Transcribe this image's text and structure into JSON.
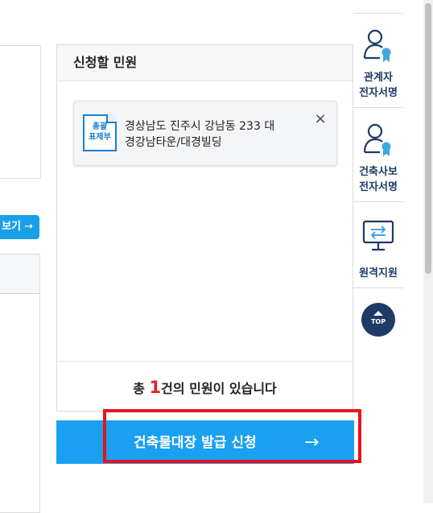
{
  "left": {
    "more_button_label": "보기",
    "more_button_arrow": "→"
  },
  "panel": {
    "title": "신청할 민원",
    "item": {
      "badge_line1": "총괄",
      "badge_line2": "표제부",
      "address_line1": "경상남도 진주시 강남동 233 대",
      "address_line2": "경강남타운/대경빌딩",
      "close_glyph": "×"
    },
    "footer": {
      "prefix": "총 ",
      "count": "1",
      "suffix": "건의 민원이 있습니다"
    }
  },
  "submit": {
    "label": "건축물대장 발급 신청",
    "arrow": "→"
  },
  "quick_menu": [
    {
      "icon": "person-cert-icon",
      "line1": "관계자",
      "line2": "전자서명"
    },
    {
      "icon": "person-cert-icon",
      "line1": "건축사보",
      "line2": "전자서명"
    },
    {
      "icon": "monitor-arrows-icon",
      "line1": "원격지원",
      "line2": ""
    }
  ],
  "top_button": "TOP",
  "colors": {
    "accent": "#1aa0f0",
    "navy": "#1e3a66",
    "count_red": "#e52127",
    "highlight": "#e8141b"
  }
}
